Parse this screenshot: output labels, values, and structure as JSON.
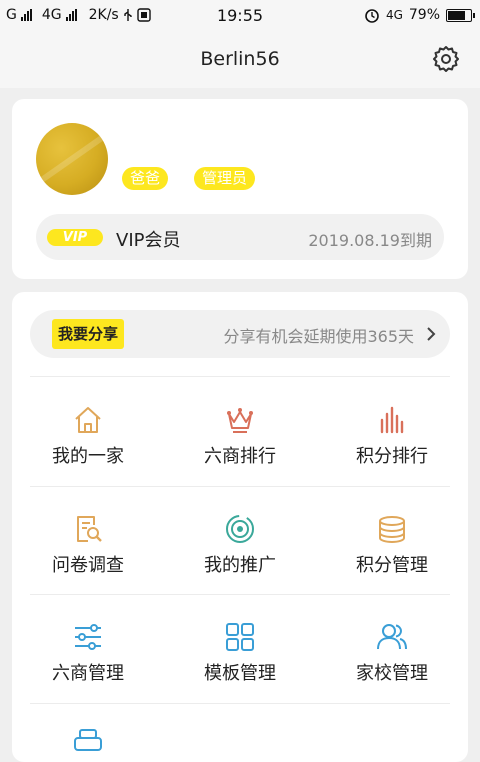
{
  "status_bar": {
    "left": "G",
    "left2": "4G",
    "speed": "2K/s",
    "time": "19:55",
    "network": "4G",
    "battery": "79%",
    "battery_level": 0.79
  },
  "header": {
    "title": "Berlin56"
  },
  "profile": {
    "tags": [
      "爸爸",
      "管理员"
    ],
    "vip_badge": "VIP",
    "vip_label": "VIP会员",
    "vip_expire": "2019.08.19到期"
  },
  "share": {
    "button": "我要分享",
    "text": "分享有机会延期使用365天"
  },
  "menu": [
    {
      "label": "我的一家",
      "icon": "house-icon"
    },
    {
      "label": "六商排行",
      "icon": "crown-icon"
    },
    {
      "label": "积分排行",
      "icon": "bar-chart-icon"
    },
    {
      "label": "问卷调查",
      "icon": "document-search-icon"
    },
    {
      "label": "我的推广",
      "icon": "target-icon"
    },
    {
      "label": "积分管理",
      "icon": "coins-stack-icon"
    },
    {
      "label": "六商管理",
      "icon": "sliders-icon"
    },
    {
      "label": "模板管理",
      "icon": "grid-icon"
    },
    {
      "label": "家校管理",
      "icon": "users-icon"
    }
  ],
  "colors": {
    "accent_yellow": "#fde71f",
    "house": "#e0a75a",
    "crown": "#d9705a",
    "bars": "#d9705a",
    "doc": "#e0a75a",
    "target": "#3aa89a",
    "coins": "#e0a75a",
    "blue": "#3a9ed6"
  }
}
